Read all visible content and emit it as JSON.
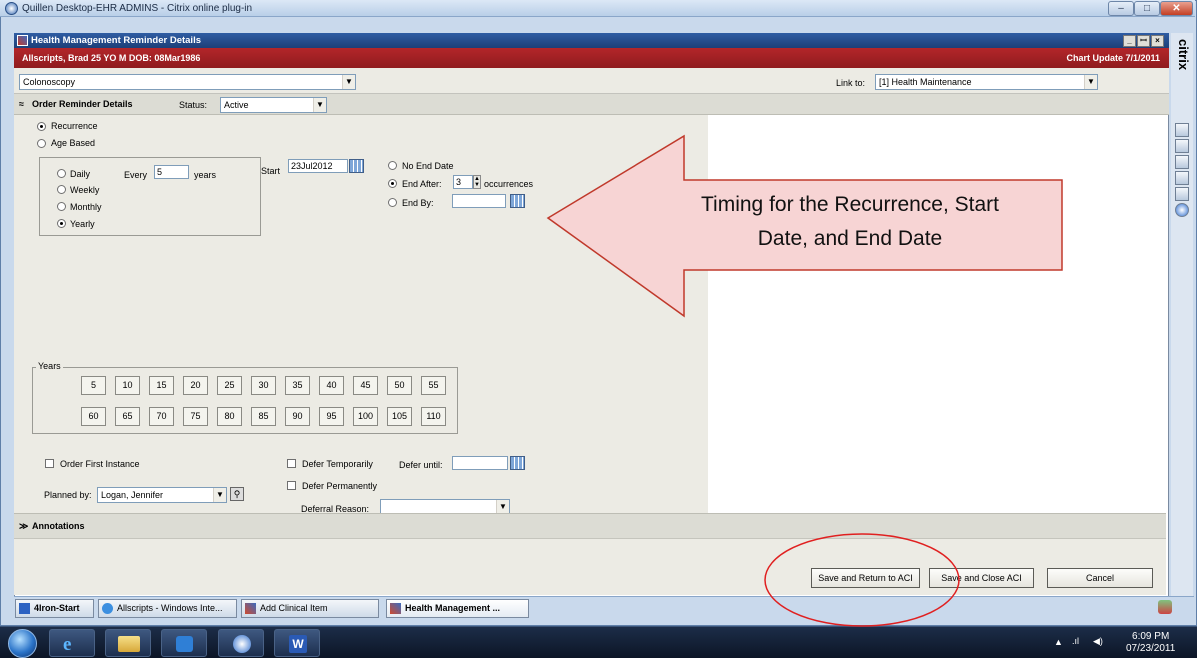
{
  "outer_window": {
    "title": "Quillen Desktop-EHR ADMINS - Citrix online plug-in",
    "brand": "citrix"
  },
  "app_window": {
    "title": "Health Management Reminder Details"
  },
  "patient": {
    "info": "Allscripts, Brad  25 YO  M DOB: 08Mar1986",
    "chart_update": "Chart Update  7/1/2011"
  },
  "reminder": {
    "name": "Colonoscopy",
    "link_to_label": "Link to:",
    "link_to_value": "[1] Health Maintenance"
  },
  "section": {
    "title": "Order Reminder Details",
    "status_label": "Status:",
    "status_value": "Active"
  },
  "schedule": {
    "type_options": [
      "Recurrence",
      "Age Based"
    ],
    "frequency_options": [
      "Daily",
      "Weekly",
      "Monthly",
      "Yearly"
    ],
    "every_label": "Every",
    "every_value": "5",
    "every_unit": "years",
    "start_label": "Start",
    "start_value": "23Jul2012",
    "end_options": [
      "No End Date",
      "End After:",
      "End By:"
    ],
    "end_after_value": "3",
    "occurrences_label": "occurrences"
  },
  "years": {
    "label": "Years",
    "row1": [
      "5",
      "10",
      "15",
      "20",
      "25",
      "30",
      "35",
      "40",
      "45",
      "50",
      "55"
    ],
    "row2": [
      "60",
      "65",
      "70",
      "75",
      "80",
      "85",
      "90",
      "95",
      "100",
      "105",
      "110"
    ]
  },
  "options": {
    "order_first_instance": "Order First Instance",
    "defer_temporarily": "Defer Temporarily",
    "defer_until": "Defer until:",
    "defer_permanently": "Defer Permanently",
    "planned_by_label": "Planned by:",
    "planned_by_value": "Logan, Jennifer",
    "deferral_reason_label": "Deferral Reason:"
  },
  "annotations": {
    "title": "Annotations"
  },
  "buttons": {
    "save_return": "Save and Return to ACI",
    "save_close": "Save and Close ACI",
    "cancel": "Cancel"
  },
  "taskbar_items": [
    "4Iron-Start",
    "Allscripts - Windows Inte...",
    "Add Clinical Item",
    "Health Management ..."
  ],
  "callout": {
    "line1": "Timing for the Recurrence, Start",
    "line2": "Date, and End Date"
  },
  "clock": {
    "time": "6:09 PM",
    "date": "07/23/2011"
  },
  "colors": {
    "patient_bar": "#a52226",
    "callout_fill": "#f7d4d4",
    "callout_stroke": "#c0392b"
  }
}
